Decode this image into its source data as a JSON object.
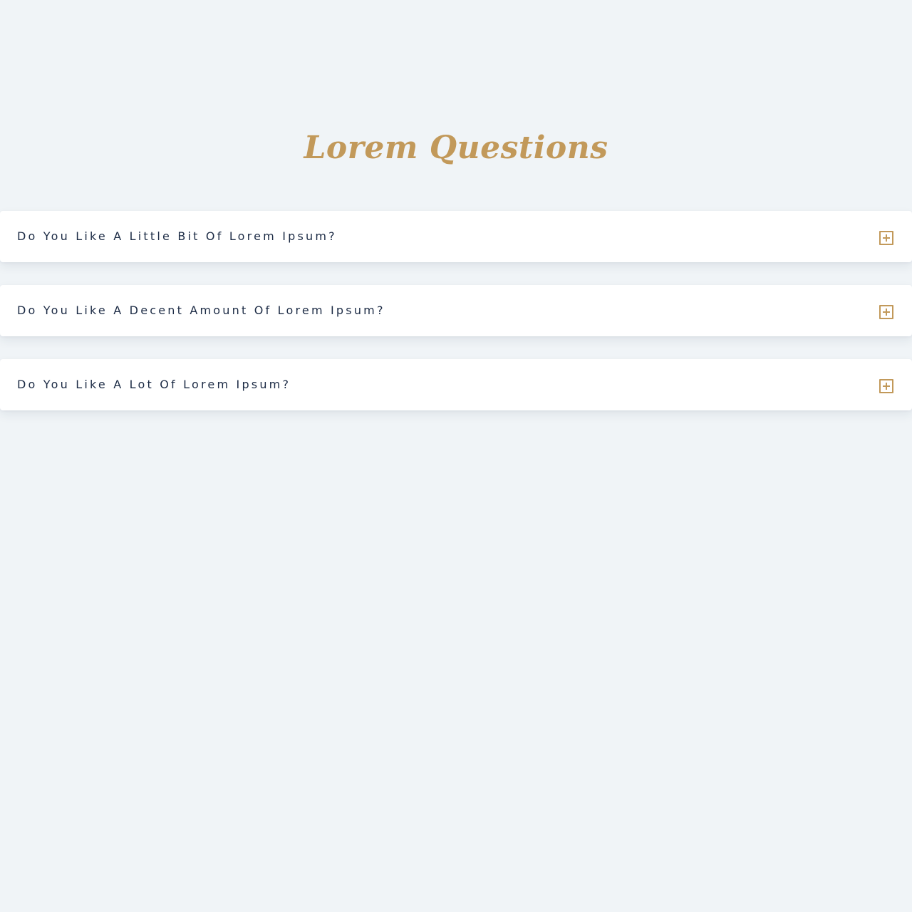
{
  "page": {
    "title": "Lorem Questions"
  },
  "faq": {
    "items": [
      {
        "question": "Do You Like A Little Bit Of Lorem Ipsum?",
        "expanded": false
      },
      {
        "question": "Do You Like A Decent Amount Of Lorem Ipsum?",
        "expanded": false
      },
      {
        "question": "Do You Like A Lot Of Lorem Ipsum?",
        "expanded": false
      }
    ],
    "toggle_icon": "plus-square-icon"
  },
  "colors": {
    "background": "#f0f4f7",
    "accent": "#c2995a",
    "text": "#1c2b45",
    "card": "#ffffff"
  }
}
